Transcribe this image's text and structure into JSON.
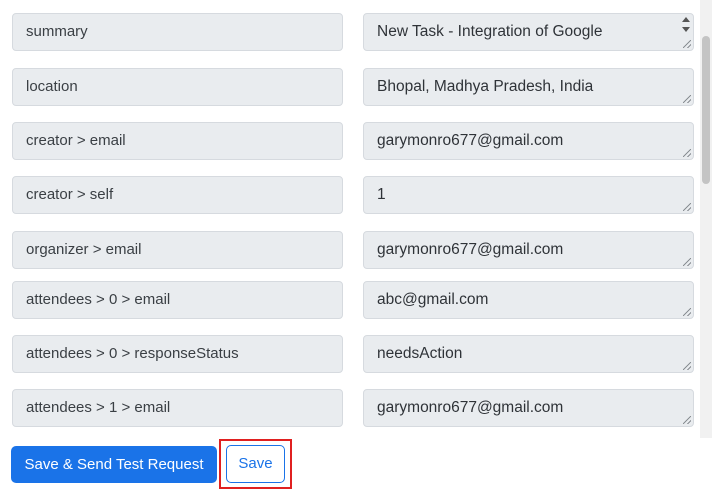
{
  "fields": [
    {
      "key": "summary",
      "value": "New Task - Integration of Google"
    },
    {
      "key": "location",
      "value": "Bhopal, Madhya Pradesh, India"
    },
    {
      "key": "creator > email",
      "value": "garymonro677@gmail.com"
    },
    {
      "key": "creator > self",
      "value": "1"
    },
    {
      "key": "organizer > email",
      "value": "garymonro677@gmail.com"
    },
    {
      "key": "attendees > 0 > email",
      "value": "abc@gmail.com"
    },
    {
      "key": "attendees > 0 > responseStatus",
      "value": "needsAction"
    },
    {
      "key": "attendees > 1 > email",
      "value": "garymonro677@gmail.com"
    }
  ],
  "buttons": {
    "save_and_send": "Save & Send Test Request",
    "save": "Save"
  },
  "colors": {
    "primary": "#1a73e8",
    "field_bg": "#e9ecef",
    "highlight": "#e02020"
  }
}
